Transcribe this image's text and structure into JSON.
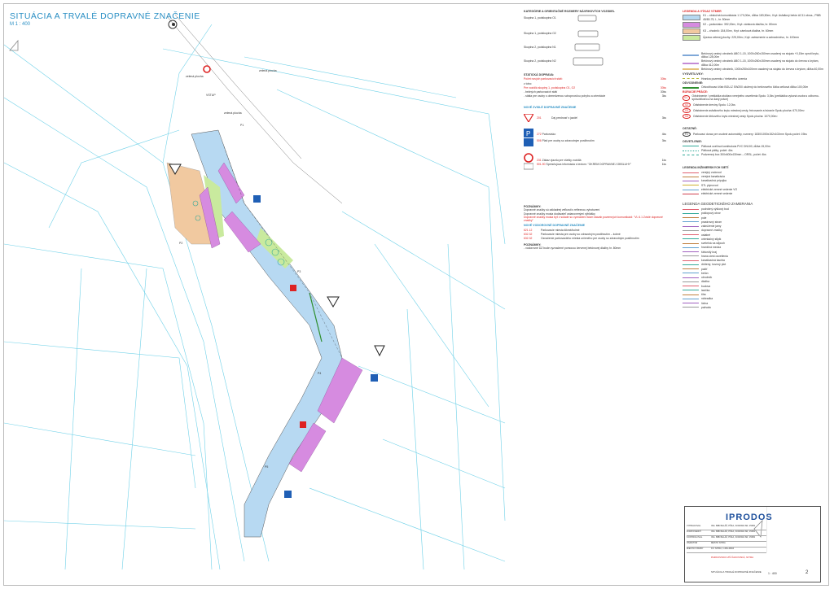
{
  "title": "SITUÁCIA A TRVALÉ DOPRAVNÉ ZNAČENIE",
  "scale": "M 1 : 400",
  "categories": {
    "heading": "KATEGÓRIE A ORIENTAČNÉ ROZMERY NÁVRHOVÝCH VOZIDIEL",
    "items": [
      "Skupina 1, podskupina O1",
      "Skupina 1, podskupina O2",
      "Skupina 2, podskupina N1",
      "Skupina 2, podskupina N2"
    ]
  },
  "static": {
    "heading": "STATICKÁ DOPRAVA:",
    "rows": [
      {
        "text": "Počet nových parkovacích státí:",
        "value": "30ks",
        "red": true
      },
      {
        "text": "z toho:",
        "value": "",
        "red": false
      },
      {
        "text": "Pre vozidlá skupiny 1, podskupina O1, O2",
        "value": "30ks",
        "red": true
      },
      {
        "text": "- bežných parkovacích státí",
        "value": "30ks",
        "red": false
      },
      {
        "text": "- státia pre osoby s obmedzenou schopnosťou pohybu a orientácie",
        "value": "3ks",
        "red": false
      }
    ]
  },
  "signs": {
    "heading": "NOVÉ ZVISLÉ DOPRAVNÉ ZNAČENIE",
    "items": [
      {
        "code": "201",
        "text": "Daj prednosť v jazde!",
        "count": "3ks"
      },
      {
        "code": "272",
        "text": "Parkovisko",
        "count": "4ks"
      },
      {
        "code": "506",
        "text": "Platí pre osoby so zdravotným postihnutím",
        "count": "3ks"
      },
      {
        "code": "231",
        "text": "Zákaz vjazdu pre všetky vozidlá",
        "count": "1ks"
      },
      {
        "code": "501-90",
        "text": "Spresňujúca informácia s textom: \"OKREM DOPRAVNEJ OBSLUHY\"",
        "count": "1ks"
      }
    ]
  },
  "notes1": {
    "heading": "POZNÁMKY:",
    "lines": [
      "Dopravné značky sú základnej veľkosti s reflexnou vyhotovení",
      "Dopravné značky musia dodávateľ ustanovenými výhlášky",
      "Dopravné značky musia byť v súlade so vyznačení istom stavab pozemných komunikácii: \"VL 6.1 Zvislé dopravné značky\""
    ]
  },
  "horizontal": {
    "heading": "NOVÉ VODOROVNÉ DOPRAVNÉ ZNAČENIE",
    "items": [
      {
        "code": "621.12",
        "text": "Parkovacie miesta šikmé/kolmé"
      },
      {
        "code": "632.32",
        "text": "Parkovacie miesta pre osoby so zdravotným postihnutím – kolmé"
      },
      {
        "code": "632.32",
        "text": "Označenie parkovacieho miesta určeného pre osoby so zdravotným postihnutím"
      }
    ]
  },
  "notes2": {
    "heading": "POZNÁMKY:",
    "lines": [
      "- vodorovné DZ bude vyznačené pomocou červenej betónovej dlažby hr. 80mm"
    ]
  },
  "legend": {
    "heading": "LEGENDA A VÝKAZ VÝMER",
    "fills": [
      {
        "color": "#b7d9f2",
        "text": "K1 – obslužná komunikácia 1 170,00m, dĺžka 183,50m², Kryt: Asfaltový betón AC11 obrus., PMB 45/80-75, I., hr. 50mm"
      },
      {
        "color": "#d68be0",
        "text": "K2 – parkovisko: 392,00m², Kryt: zámková dlažba, hr. 80mm"
      },
      {
        "color": "#f1c9a0",
        "text": "K3 – chodník: 184,00m², Kryt: zámková dlažba, hr. 60mm"
      },
      {
        "color": "#c9ea9e",
        "text": "Úprava zelenej plochy: 225,00m², Kryt: zatrávnenie a zahradníctvo, hr. 100mm"
      }
    ],
    "lines": [
      {
        "color": "#7fa8d8",
        "text": "Betónový cestný obrubník ABO 1-15, 1000x260x150mm osadený na stojato +0,15m oproti krytu, dĺžka 128,00m"
      },
      {
        "color": "#c48bd6",
        "text": "Betónový cestný obrubník ABO 1-15, 1000x260x150mm osadený na stojato do črevna s krytom, dĺžka 412,00m"
      },
      {
        "color": "#e5c07a",
        "text": "Betónový cestný obrubník, 1000x250x100mm osadený na stojato do črevna s krytom, dĺžka 40,00m"
      }
    ],
    "vysv_head": "VYSVETLIVKY:",
    "vysv": "Hranica pozemku / riešeného územia",
    "odv_head": "ODVODNENIE:",
    "odv": "Odvodňovací žľab BGU-Z SW200 uložený do betónového lôžka celková dĺžka 100,00m",
    "bur_head": "BÚRACIE PRÁCE:",
    "bur": [
      {
        "code": "01",
        "text": "Odstránenie / prekládka stožiara verejného osvetlenia Spolu: 3,0ks (prekládka vykoná osoba s odborno-spôsobilosťou na daný práce)"
      },
      {
        "code": "02",
        "text": "Odstránenie dreviny Spolu: 12,0ks"
      },
      {
        "code": "03",
        "text": "Odstránenie asfaltového krytu miestnej cesty, frézovanie a búranie Spolu plocha: 670,00m²"
      },
      {
        "code": "04",
        "text": "Odstránenie štrkového krytu miestnej cesty Spolu plocha: 1070,00m²"
      }
    ],
    "ostatne_head": "OSTATNÉ:",
    "ostatne": [
      {
        "code": "P2",
        "text": "Parkovací doraz pre osobné automobily, rozmery: 1830/1000x152x102mm Spolu počet: 19ks"
      }
    ],
    "osv_head": "OSVETLENIE:",
    "osv": [
      "Pätková oceľová konštrukcia PVC DN100, dĺžka 15,00m",
      "Pätková pätky, počet: 4ks",
      "Podzemný box 300x600x430mm – ORSL, počet: 4ks"
    ],
    "net_head": "LEGENDA INŽINIERSKYCH SIETÍ",
    "nets": [
      {
        "color": "#e06070",
        "text": "verejný vodovod"
      },
      {
        "color": "#c08040",
        "text": "verejná kanalizácia"
      },
      {
        "color": "#a060c0",
        "text": "kanalizačná prípojka"
      },
      {
        "color": "#d0b030",
        "text": "STL plynovod"
      },
      {
        "color": "#60a0d0",
        "text": "elektrické zemné vedenie VO"
      },
      {
        "color": "#d04050",
        "text": "elektrické zemné vedenie"
      }
    ],
    "geo_head": "LEGENDA GEODETICKÉHO ZAMERANIA",
    "geo": [
      "podrobný výškový bod",
      "poklopový otvor",
      "pole",
      "prastrovný strom",
      "zakrúženie jamy",
      "dopravné značky",
      "ostatné",
      "orientačný stĺpik",
      "svetelná na stĺpoch",
      "hraničná medza",
      "štrkovitý kraj",
      "hrana ciest osvetlenia",
      "kanalizačná šachta",
      "drôtený, kovový plot",
      "pažiť",
      "betón",
      "obrubník",
      "dlažba",
      "budova",
      "lavička",
      "tiňa",
      "náhradka",
      "lúčna",
      "pažvala"
    ]
  },
  "map_labels": [
    "zelená plocha",
    "zelená plocha",
    "zelená plocha",
    "VSTUP",
    "P1",
    "P2",
    "P3",
    "P4",
    "P5"
  ],
  "titleblock": {
    "company": "IPRODOS",
    "project": "PARKOVISKO ZŠ ČAKOVSKÁ, NITRA",
    "drawing": "SITUÁCIA A TRVALÉ DOPRAVNÉ ZNAČENIE",
    "scale": "1 : 400",
    "sheet": "2",
    "rows": [
      {
        "k": "VYPRACOVAL",
        "v": "ING. BIBI BALÁŽ, PŠKA, KOMORA SR, 15082"
      },
      {
        "k": "ZODPOVEDNÝ",
        "v": "ING. BIBI BALÁŽ, PŠKA, KOMORA SR, 15082"
      },
      {
        "k": "KONTROLOVAL",
        "v": "ING. BIBI BALÁŽ, PŠKA, KOMORA SR, 15082"
      },
      {
        "k": "INVESTOR",
        "v": "MESTO NITRA"
      },
      {
        "k": "MIESTO STAVBY",
        "v": "KÚ. NITRA, 1.481-482/4"
      }
    ]
  },
  "colors": {
    "road": "#b7d9f2",
    "parking": "#d68be0",
    "walk": "#f1c9a0",
    "green": "#c9ea9e",
    "parcel": "#6fd1e8",
    "accent": "#2a8fc4"
  }
}
